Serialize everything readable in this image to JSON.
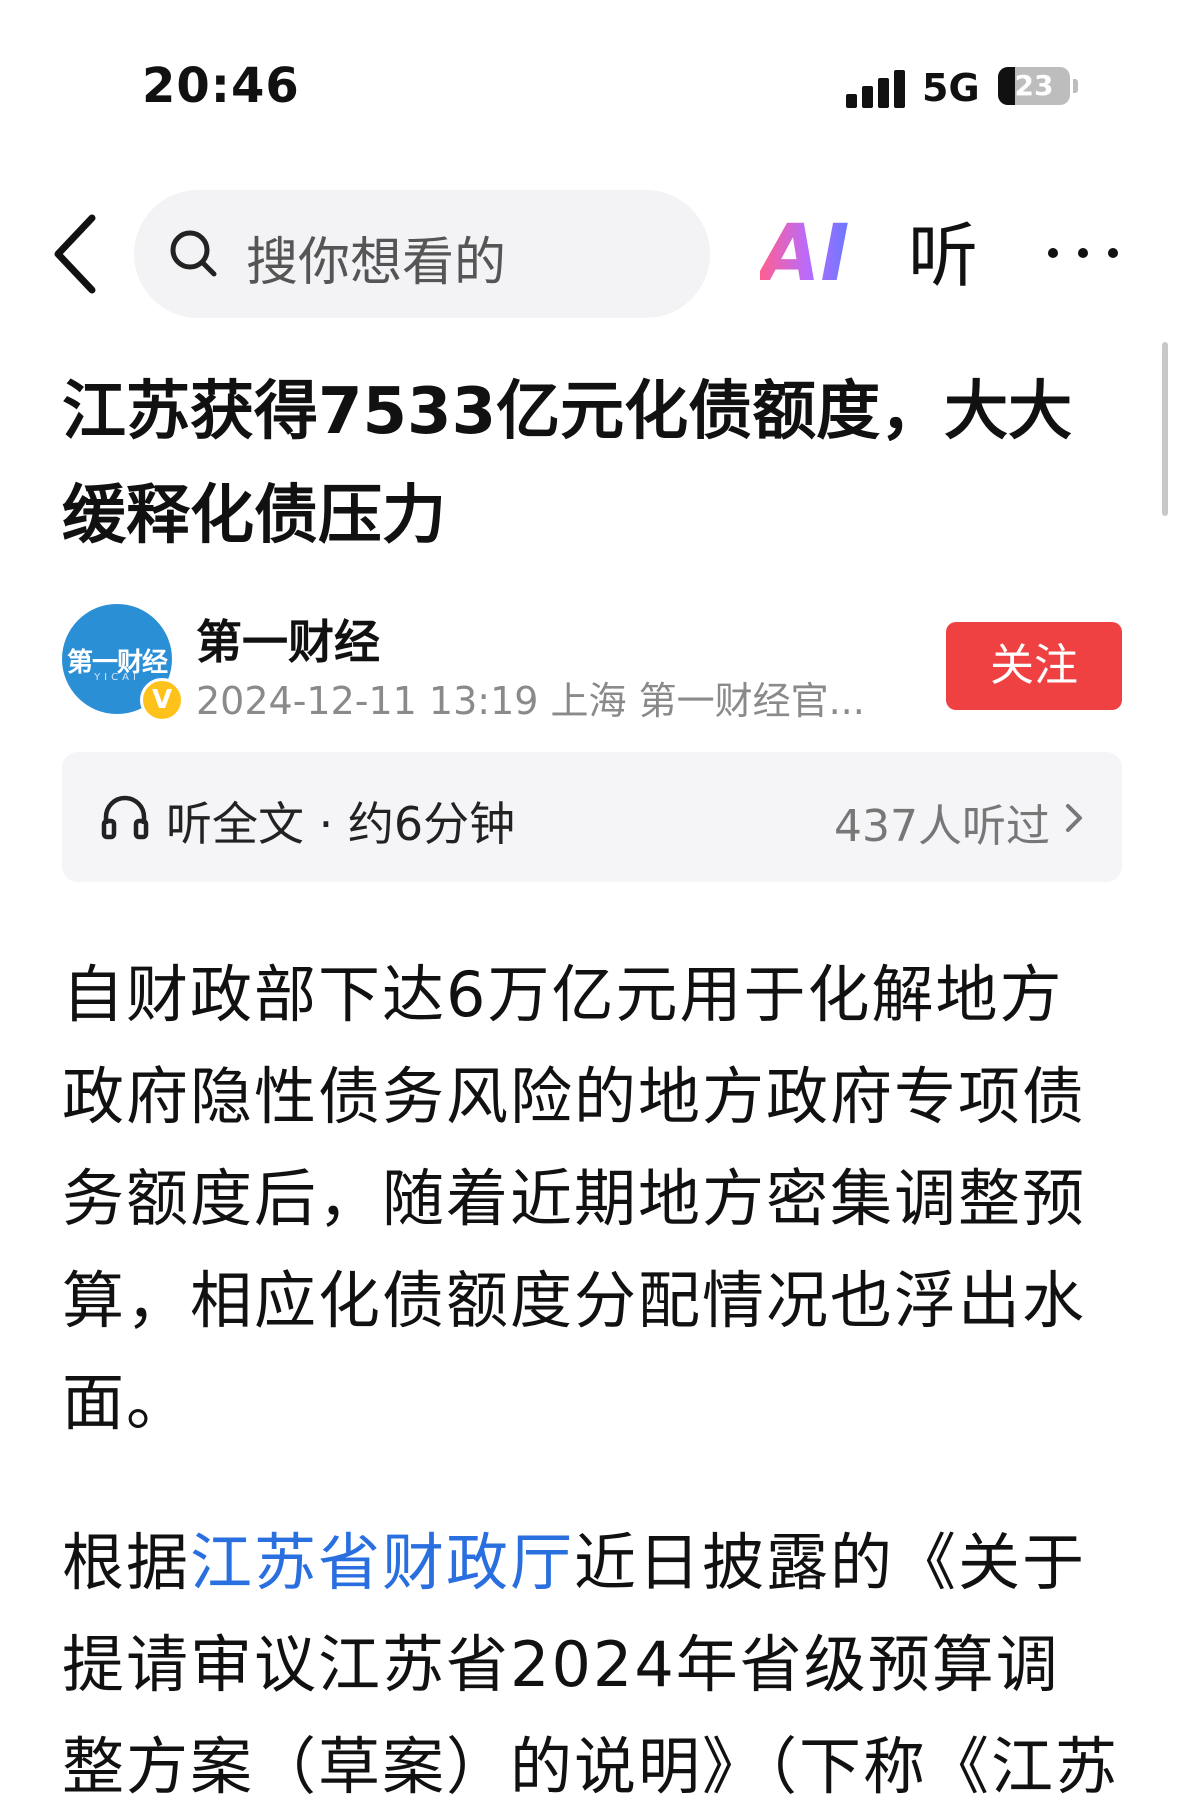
{
  "status_bar": {
    "time": "20:46",
    "network": "5G",
    "battery": "23",
    "battery_level_percent": 23
  },
  "nav": {
    "search_placeholder": "搜你想看的",
    "ai_label": "AI",
    "listen_label": "听"
  },
  "article": {
    "title": "江苏获得7533亿元化债额度，大大缓释化债压力",
    "author": {
      "name": "第一财经",
      "logo_text": "第一财经",
      "logo_sub": "YICAI",
      "verified_mark": "V",
      "meta": "2024-12-11 13:19 上海 第一财经官..."
    },
    "follow_label": "关注",
    "listen_bar": {
      "label": "听全文 · 约6分钟",
      "count": "437人听过"
    },
    "paragraph1": "自财政部下达6万亿元用于化解地方政府隐性债务风险的地方政府专项债务额度后，随着近期地方密集调整预算，相应化债额度分配情况也浮出水面。",
    "paragraph2": {
      "prefix": "根据",
      "link": "江苏省财政厅",
      "suffix": "近日披露的《关于提请审议江苏省2024年省级预算调整方案（草案）的说明》（下称《江苏"
    }
  },
  "colors": {
    "follow_button": "#f04142",
    "link": "#2a6fe0",
    "avatar": "#2b8fd6",
    "verified": "#ffc21a"
  }
}
